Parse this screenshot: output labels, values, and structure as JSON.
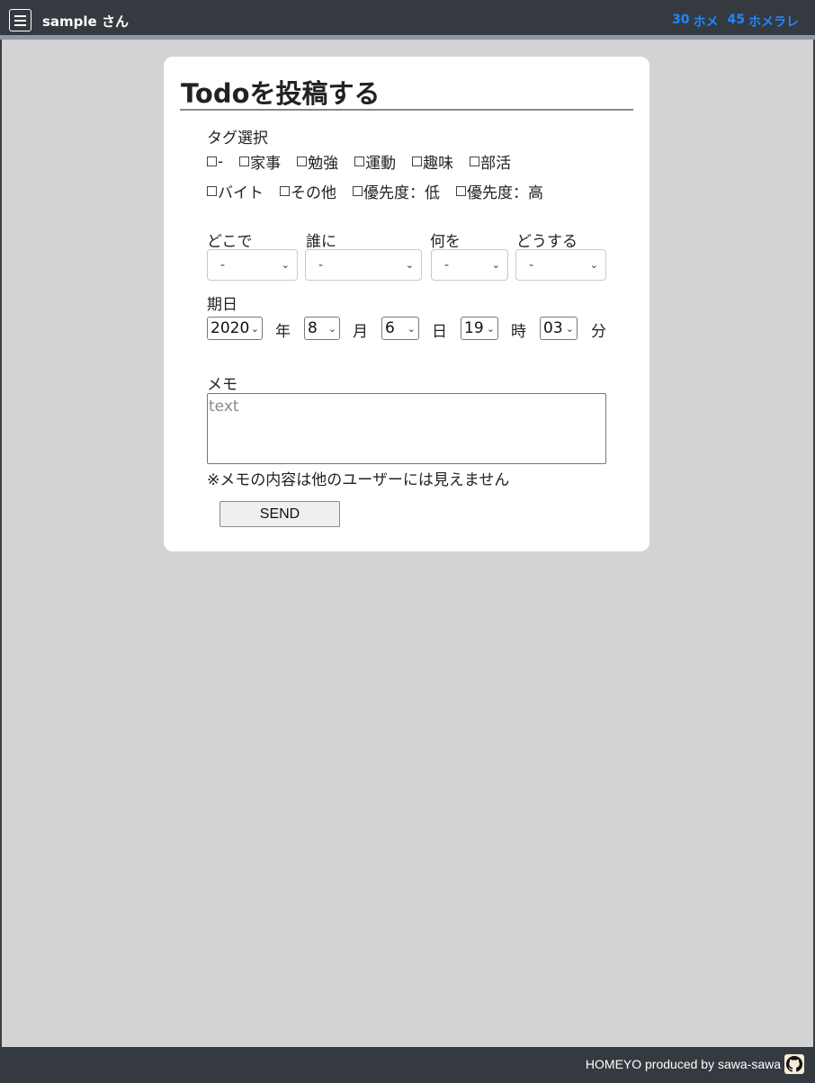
{
  "header": {
    "user_name": "sample さん",
    "stat1": {
      "count": "30",
      "label": "ホメ"
    },
    "stat2": {
      "count": "45",
      "label": "ホメラレ"
    }
  },
  "form": {
    "title": "Todoを投稿する",
    "tag_label": "タグ選択",
    "tags_row1": [
      "-",
      "家事",
      "勉強",
      "運動",
      "趣味",
      "部活"
    ],
    "tags_row2": [
      "バイト",
      "その他",
      "優先度：低",
      "優先度：高"
    ],
    "where_label": "どこで",
    "who_label": "誰に",
    "what_label": "何を",
    "how_label": "どうする",
    "where_value": "-",
    "who_value": "-",
    "what_value": "-",
    "how_value": "-",
    "date_label": "期日",
    "year": "2020",
    "year_unit": "年",
    "month": "8",
    "month_unit": "月",
    "day": "6",
    "day_unit": "日",
    "hour": "19",
    "hour_unit": "時",
    "minute": "03",
    "minute_unit": "分",
    "memo_label": "メモ",
    "memo_placeholder": "text",
    "memo_note": "※メモの内容は他のユーザーには見えません",
    "send_label": "SEND"
  },
  "footer": {
    "credit": "HOMEYO produced by sawa-sawa"
  },
  "colors": {
    "header_bg": "#343a40",
    "accent": "#1e88ff",
    "page_bg": "#d3d3d3"
  },
  "icons": {
    "menu": "hamburger-menu-icon",
    "github": "github-icon"
  }
}
